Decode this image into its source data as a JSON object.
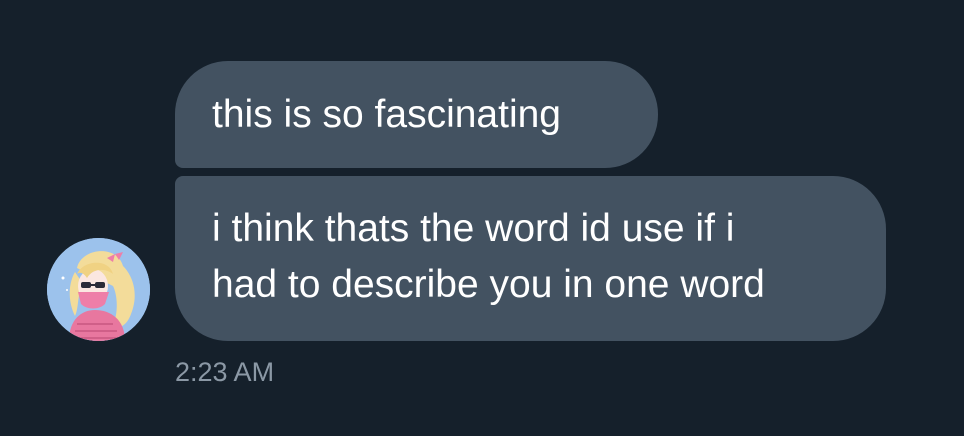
{
  "conversation": {
    "messages": [
      {
        "lines": [
          "this is so fascinating"
        ]
      },
      {
        "lines": [
          "i think thats the word id use if i",
          "had to describe you in one word"
        ]
      }
    ],
    "timestamp": "2:23 AM",
    "avatar": {
      "icon": "user-avatar-icon",
      "description_colors": {
        "background": "#9cc2ec",
        "hair": "#f3dc9a",
        "outfit": "#e8779f"
      }
    }
  },
  "colors": {
    "background": "#15202b",
    "bubble": "#435261",
    "text": "#ffffff",
    "timestamp": "#8b98a5"
  }
}
